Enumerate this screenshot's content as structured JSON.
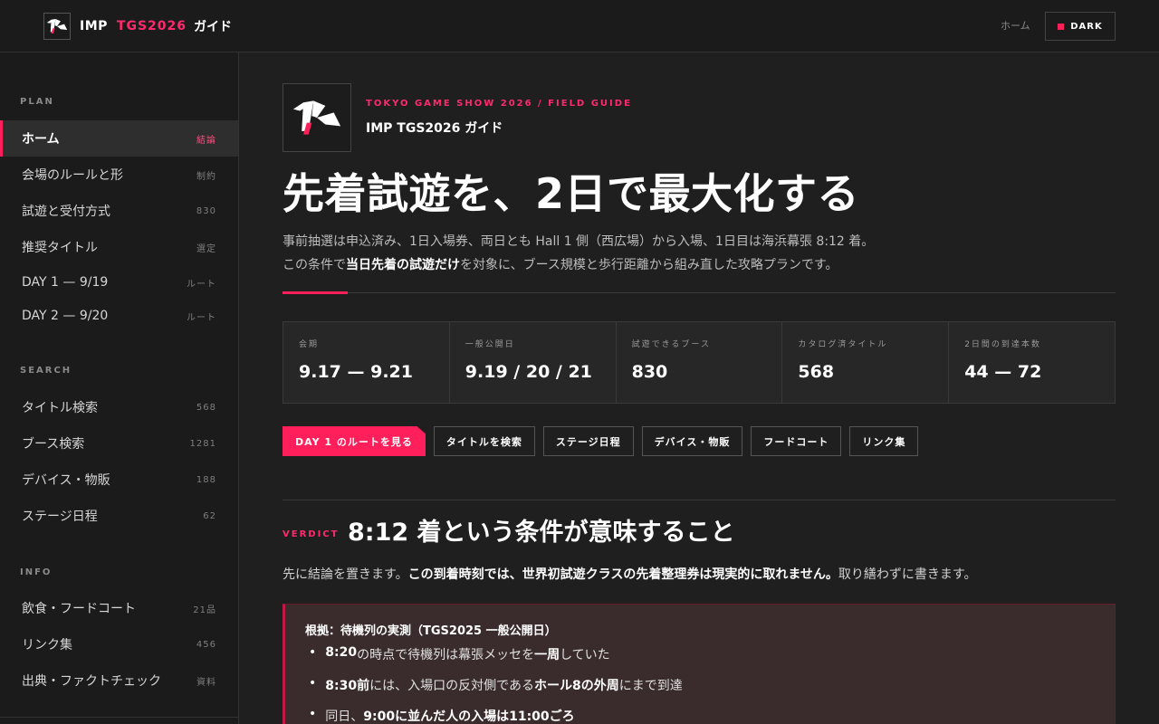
{
  "header": {
    "brand_imp": "IMP",
    "brand_tgs": "TGS2026",
    "brand_guide": "ガイド",
    "home_link": "ホーム",
    "theme_toggle": "DARK"
  },
  "sidebar": {
    "sections": [
      {
        "title": "PLAN",
        "items": [
          {
            "label": "ホーム",
            "meta": "結論",
            "active": true
          },
          {
            "label": "会場のルールと形",
            "meta": "制約"
          },
          {
            "label": "試遊と受付方式",
            "meta": "830"
          },
          {
            "label": "推奨タイトル",
            "meta": "選定"
          },
          {
            "label": "DAY 1 — 9/19",
            "meta": "ルート"
          },
          {
            "label": "DAY 2 — 9/20",
            "meta": "ルート"
          }
        ]
      },
      {
        "title": "SEARCH",
        "items": [
          {
            "label": "タイトル検索",
            "meta": "568"
          },
          {
            "label": "ブース検索",
            "meta": "1281"
          },
          {
            "label": "デバイス・物販",
            "meta": "188"
          },
          {
            "label": "ステージ日程",
            "meta": "62"
          }
        ]
      },
      {
        "title": "INFO",
        "items": [
          {
            "label": "飲食・フードコート",
            "meta": "21品"
          },
          {
            "label": "リンク集",
            "meta": "456"
          },
          {
            "label": "出典・ファクトチェック",
            "meta": "資料"
          }
        ]
      }
    ]
  },
  "hero": {
    "eyebrow": "TOKYO GAME SHOW 2026 / FIELD GUIDE",
    "guide_name": "IMP TGS2026 ガイド",
    "headline": "先着試遊を、2日で最大化する",
    "lead_line1": "事前抽選は申込済み、1日入場券、両日とも Hall 1 側（西広場）から入場、1日目は海浜幕張 8:12 着。",
    "lead_line2_pre": "この条件で",
    "lead_line2_bold": "当日先着の試遊だけ",
    "lead_line2_post": "を対象に、ブース規模と歩行距離から組み直した攻略プランです。"
  },
  "stats": [
    {
      "label": "会期",
      "value": "9.17 — 9.21"
    },
    {
      "label": "一般公開日",
      "value": "9.19 / 20 / 21"
    },
    {
      "label": "試遊できるブース",
      "value": "830"
    },
    {
      "label": "カタログ済タイトル",
      "value": "568"
    },
    {
      "label": "2日間の到達本数",
      "value": "44 — 72"
    }
  ],
  "actions": {
    "primary": "DAY 1 のルートを見る",
    "search_titles": "タイトルを検索",
    "stage_schedule": "ステージ日程",
    "devices": "デバイス・物販",
    "food_court": "フードコート",
    "links": "リンク集"
  },
  "verdict": {
    "tag": "VERDICT",
    "title": "8:12 着という条件が意味すること",
    "text_pre": "先に結論を置きます。",
    "text_bold": "この到着時刻では、世界初試遊クラスの先着整理券は現実的に取れません。",
    "text_post": "取り繕わずに書きます。"
  },
  "evidence": {
    "title": "根拠：待機列の実測（TGS2025 一般公開日）",
    "items": [
      {
        "b1": "8:20",
        "t1": " の時点で待機列は幕張メッセを",
        "b2": "一周",
        "t2": "していた"
      },
      {
        "b1": "8:30前",
        "t1": "には、入場口の反対側である",
        "b2": "ホール8の外周",
        "t2": "にまで到達"
      },
      {
        "b1": "",
        "t1": "同日、",
        "b2": "9:00に並んだ人の入場は11:00ごろ",
        "t2": ""
      }
    ]
  }
}
